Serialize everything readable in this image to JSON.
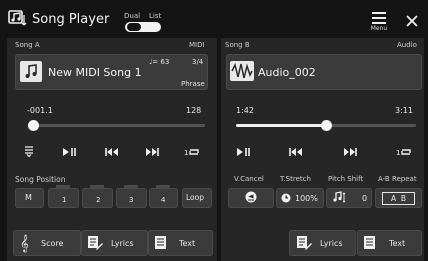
{
  "header": {
    "title": "Song Player",
    "dual_label": "Dual",
    "list_label": "List",
    "menu_label": "Menu"
  },
  "song_a": {
    "section_label": "Song A",
    "type_label": "MIDI",
    "tempo": "♩= 63",
    "time_sig": "3/4",
    "mode": "Phrase",
    "name": "New MIDI Song 1",
    "position": "-001.1",
    "length": "128",
    "progress": 0.0
  },
  "song_b": {
    "section_label": "Song B",
    "type_label": "Audio",
    "name": "Audio_002",
    "position": "1:42",
    "length": "3:11",
    "progress": 0.5
  },
  "song_position": {
    "label": "Song Position",
    "m_label": "M",
    "markers": [
      "1",
      "2",
      "3",
      "4"
    ],
    "loop_label": "Loop"
  },
  "audio_controls": {
    "vcancel_label": "V.Cancel",
    "tstretch_label": "T.Stretch",
    "pitch_label": "Pitch Shift",
    "ab_label": "A-B Repeat",
    "tstretch_value": "100%",
    "pitch_value": "0",
    "ab_value": "A  B"
  },
  "bottom_a": {
    "score_label": "Score",
    "lyrics_label": "Lyrics",
    "text_label": "Text"
  },
  "bottom_b": {
    "lyrics_label": "Lyrics",
    "text_label": "Text"
  }
}
